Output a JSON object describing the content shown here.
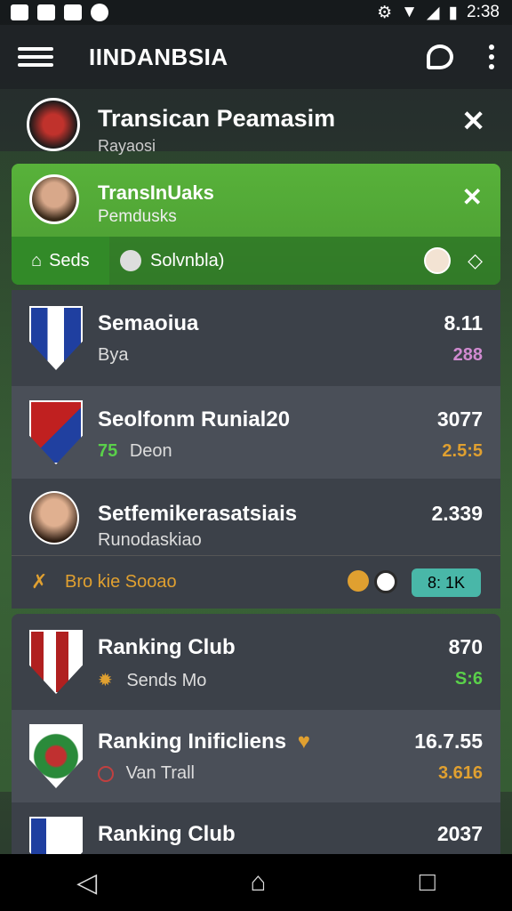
{
  "status": {
    "time": "2:38"
  },
  "appbar": {
    "title": "IINDANBSIA"
  },
  "hero": {
    "title": "Transican Peamasim",
    "subtitle": "Rayaosi"
  },
  "promo": {
    "title": "TransInUaks",
    "subtitle": "Pemdusks",
    "tab_left": "Seds",
    "tab_right": "Solvnbla)"
  },
  "list": [
    {
      "name": "Semaoiua",
      "sub": "Bya",
      "value": "8.11",
      "sub_value": "288"
    },
    {
      "name": "Seolfonm Runial20",
      "prefix": "75",
      "sub": "Deon",
      "value": "3077",
      "sub_value": "2.5:5"
    },
    {
      "name": "Setfemikerasatsiais",
      "sub": "Runodaskiao",
      "value": "2.339"
    }
  ],
  "strip": {
    "label": "Bro kie Sooao",
    "pill": "8: 1K"
  },
  "ranking": [
    {
      "name": "Ranking Club",
      "sub": "Sends Mo",
      "value": "870",
      "sub_value": "S:6"
    },
    {
      "name": "Ranking Inificliens",
      "sub": "Van Trall",
      "value": "16.7.55",
      "sub_value": "3.616"
    },
    {
      "name": "Ranking Club",
      "value": "2037"
    }
  ],
  "colors": {
    "green": "#58b23a",
    "orange": "#e0a030",
    "teal": "#49b7a8"
  }
}
